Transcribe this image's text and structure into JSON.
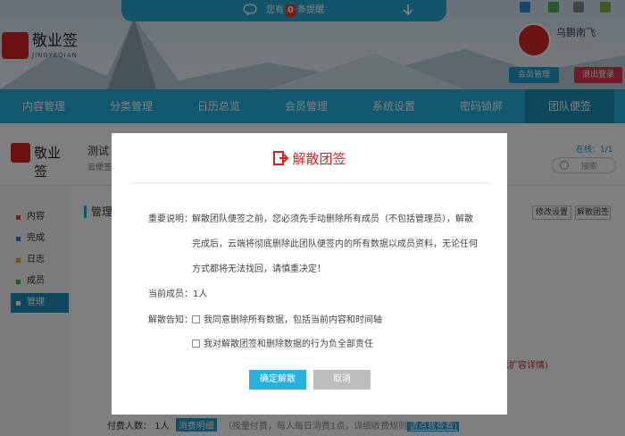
{
  "notice": {
    "prefix": "您有",
    "count": "0",
    "suffix": "条提醒"
  },
  "brand": {
    "name": "敬业签",
    "sub": "JINGYEQIAN"
  },
  "user": {
    "name": "乌鹏南飞",
    "member_btn": "会员管理",
    "logout_btn": "退出登录"
  },
  "nav": {
    "items": [
      {
        "label": "内容管理"
      },
      {
        "label": "分类管理"
      },
      {
        "label": "日历总览"
      },
      {
        "label": "会员管理"
      },
      {
        "label": "系统设置"
      },
      {
        "label": "密码锁屏"
      },
      {
        "label": "团队便签"
      }
    ]
  },
  "group": {
    "logo_name": "敬业签",
    "title": "测试",
    "sub": "云便签",
    "online": "在线：1/1",
    "search_placeholder": "搜索"
  },
  "sidebar": {
    "items": [
      {
        "label": "内容",
        "color": "#e23b3b"
      },
      {
        "label": "完成",
        "color": "#3b6ee2"
      },
      {
        "label": "日志",
        "color": "#f0a020"
      },
      {
        "label": "成员",
        "color": "#3bb24a"
      },
      {
        "label": "管理",
        "color": "#ffffff"
      }
    ]
  },
  "main": {
    "title": "管理",
    "edit_btn": "修改设置",
    "dissolve_btn": "解散团签",
    "expand_text": "已扩容详情)",
    "fee_label": "付费人数：",
    "fee_count": "1人",
    "fee_tag": "消费明细",
    "fee_note": "（按量付费，每人每日消费1点，详细收费规则",
    "fee_link": "请点我查看)"
  },
  "modal": {
    "title": "解散团签",
    "desc_label": "重要说明：",
    "desc_lines": [
      "解散团队便签之前，您必须先手动删除所有成员（不包括管理员），解散",
      "完成后，云端将彻底删除此团队便签内的所有数据以成员资料，无论任何",
      "方式都将无法找回，请慎重决定！"
    ],
    "member_label": "当前成员：",
    "member_value": "1人",
    "notice_label": "解散告知：",
    "checks": [
      {
        "label": "我同意删除所有数据，包括当前内容和时间轴"
      },
      {
        "label": "我对解散团签和删除数据的行为负全部责任"
      }
    ],
    "confirm_btn": "确定解散",
    "cancel_btn": "取消"
  }
}
